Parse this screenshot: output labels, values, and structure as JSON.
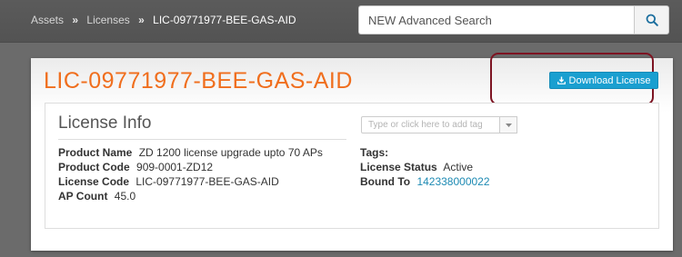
{
  "breadcrumb": {
    "items": [
      "Assets",
      "Licenses"
    ],
    "separator": "»",
    "current": "LIC-09771977-BEE-GAS-AID"
  },
  "search": {
    "placeholder": "NEW Advanced Search",
    "icon": "search-icon"
  },
  "license": {
    "title": "LIC-09771977-BEE-GAS-AID",
    "download_label": "Download License",
    "download_icon": "download-icon"
  },
  "license_info": {
    "heading": "License Info",
    "tag_placeholder": "Type or click here to add tag",
    "left_fields": [
      {
        "label": "Product Name",
        "value": "ZD 1200 license upgrade upto 70 APs"
      },
      {
        "label": "Product Code",
        "value": "909-0001-ZD12"
      },
      {
        "label": "License Code",
        "value": "LIC-09771977-BEE-GAS-AID"
      },
      {
        "label": "AP Count",
        "value": "45.0"
      }
    ],
    "right_fields": [
      {
        "label": "Tags:",
        "value": ""
      },
      {
        "label": "License Status",
        "value": "Active"
      },
      {
        "label": "Bound To",
        "value": "142338000022"
      }
    ]
  },
  "colors": {
    "title_orange": "#f06e1d",
    "button_blue": "#1a9fd0",
    "link_blue": "#1d8ab3",
    "highlight_red": "#7d1422"
  }
}
